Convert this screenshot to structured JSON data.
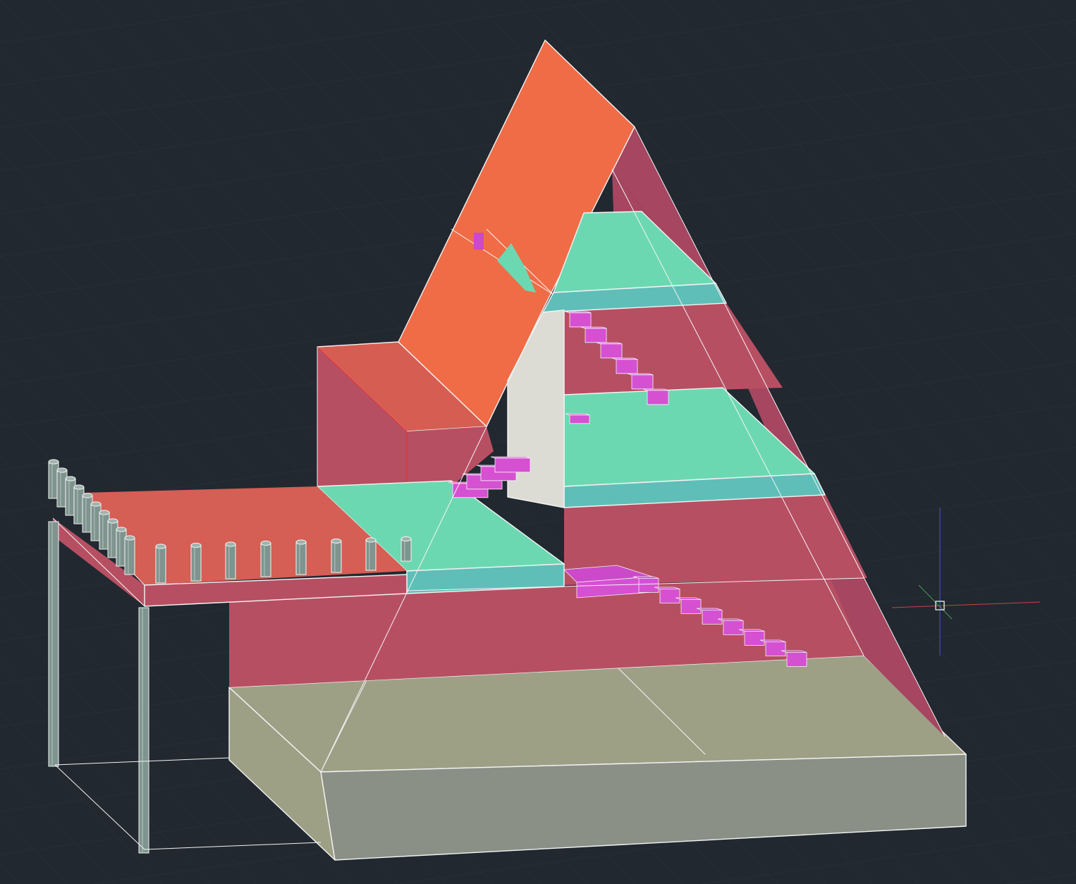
{
  "viewport": {
    "kind": "3d-model-view",
    "background": "#212830",
    "visual_style": "shaded-with-edges"
  },
  "model": {
    "subject": "a-frame-house-section",
    "colors": {
      "roof": "#f06c46",
      "roof_dark": "#d65d52",
      "wall": "#b74f63",
      "wall_dark": "#a64660",
      "floor_top": "#6cd8b1",
      "floor_edge": "#5fbfb8",
      "stairs": "#cc49c9",
      "partition": "#dcdbd4",
      "foundation_top": "#9ea086",
      "foundation_front": "#8a9086",
      "column": "#7f948e",
      "deck": "#d55e55"
    },
    "counts": {
      "floors": 3,
      "stair_runs": 4,
      "deck_posts": 18,
      "support_columns": 2
    }
  },
  "ucs_icon": {
    "x_axis_color": "#d04040",
    "y_axis_color": "#4a9a4a",
    "z_axis_color": "#5050cc"
  }
}
